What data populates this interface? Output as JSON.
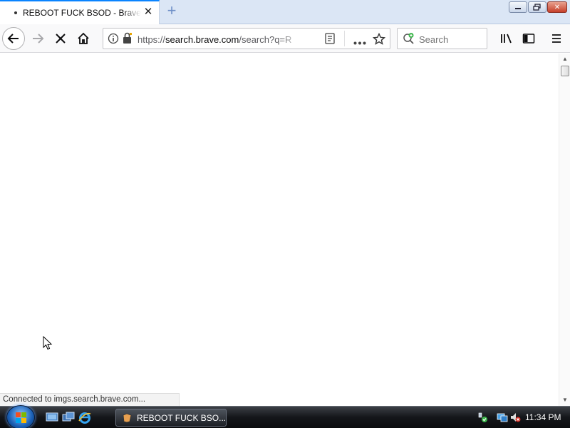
{
  "browser": {
    "tab": {
      "title": "REBOOT FUCK BSOD - Brave Se",
      "loading": true
    },
    "newtab_icon": "plus-icon",
    "window_controls": [
      "minimize-icon",
      "restore-icon",
      "close-icon"
    ],
    "nav": {
      "back_icon": "back-arrow-icon",
      "forward_icon": "forward-arrow-icon",
      "stop_icon": "stop-icon",
      "home_icon": "home-icon"
    },
    "url": {
      "scheme": "https://",
      "host": "search.brave.com",
      "path": "/search?q=R"
    },
    "search": {
      "placeholder": "Search"
    },
    "toolbar_icons": [
      "library-icon",
      "sidebar-icon",
      "menu-icon"
    ],
    "status_text": "Connected to imgs.search.brave.com..."
  },
  "taskbar": {
    "start_icon": "windows-start-icon",
    "quicklaunch": [
      "show-desktop-icon",
      "switch-windows-icon",
      "internet-explorer-icon"
    ],
    "task_label": "REBOOT FUCK BSO...",
    "tray_icons": [
      "network-icon",
      "display-icon",
      "volume-muted-icon"
    ],
    "clock": "11:34 PM"
  },
  "colors": {
    "accent": "#0a84ff",
    "tabbar": "#dbe6f5",
    "taskbar": "#14161a"
  }
}
